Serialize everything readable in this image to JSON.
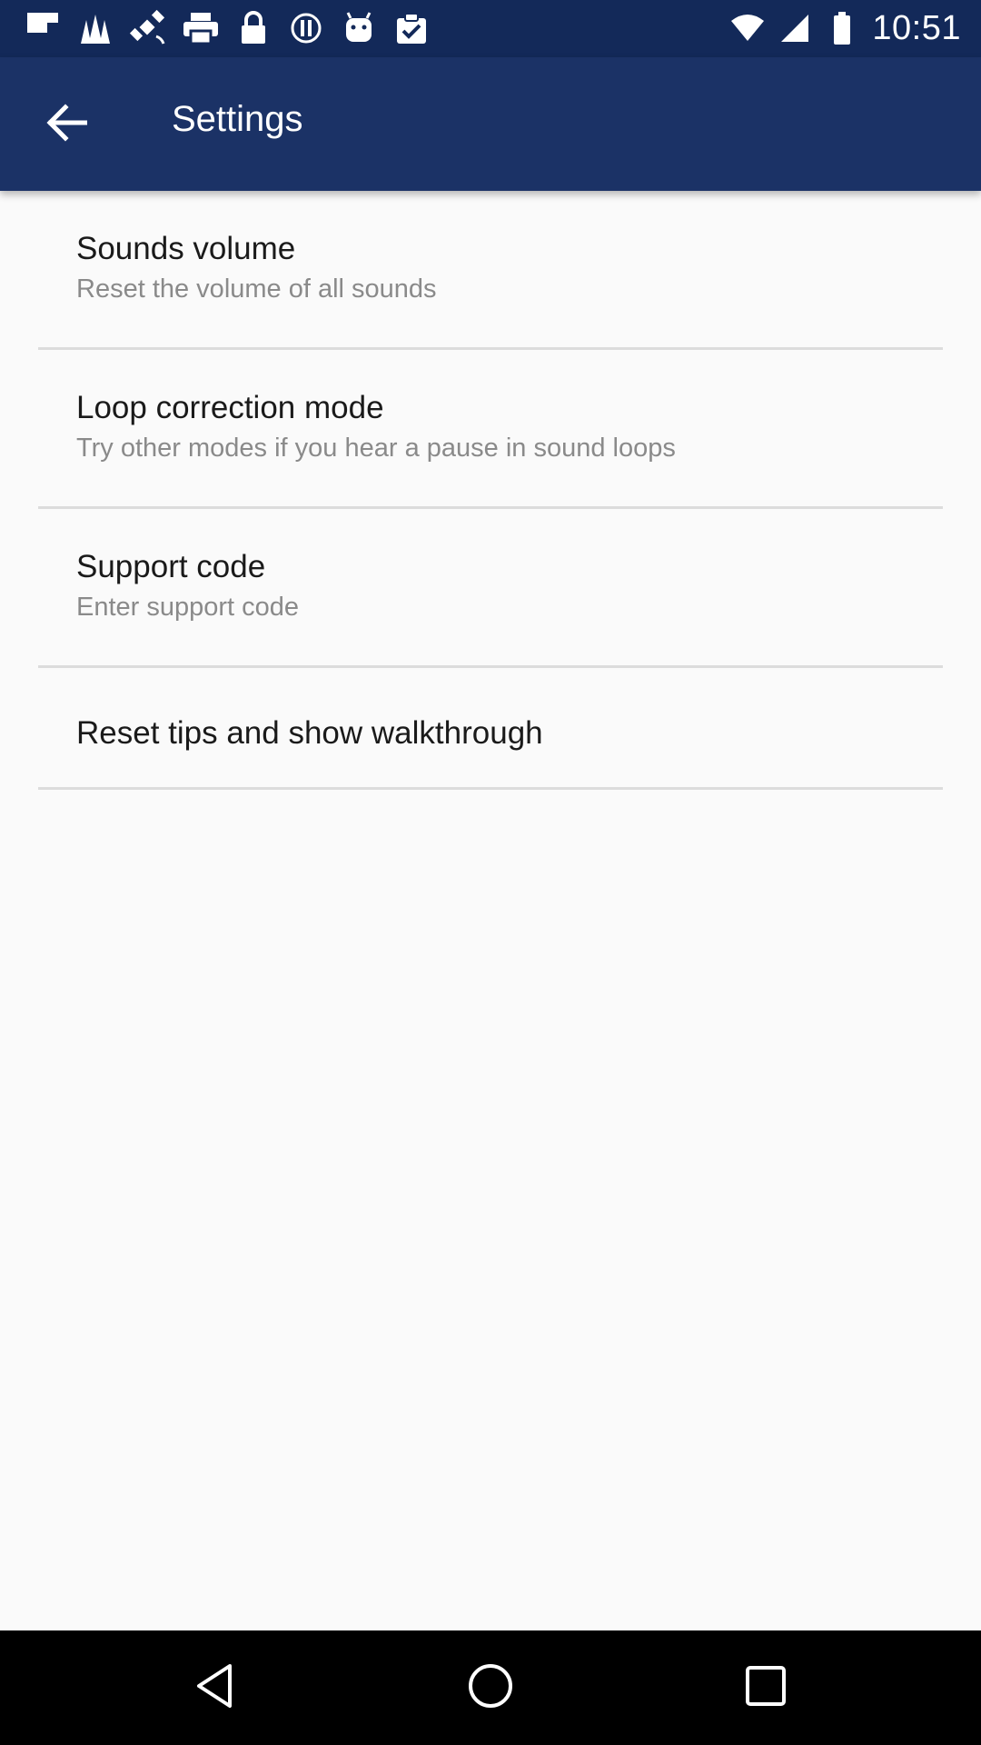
{
  "status_bar": {
    "time": "10:51",
    "left_icons": [
      "flipboard-icon",
      "grass-icon",
      "satellite-fake-icon",
      "printer-icon",
      "lock-icon",
      "info-circle-icon",
      "android-icon",
      "clipboard-check-icon"
    ],
    "right_icons": [
      "wifi-icon",
      "signal-icon",
      "battery-icon"
    ]
  },
  "app_bar": {
    "title": "Settings",
    "back_icon": "arrow-back-icon",
    "background": "#1b3266"
  },
  "settings": [
    {
      "title": "Sounds volume",
      "subtitle": "Reset the volume of all sounds"
    },
    {
      "title": "Loop correction mode",
      "subtitle": "Try other modes if you hear a pause in sound loops"
    },
    {
      "title": "Support code",
      "subtitle": "Enter support code"
    },
    {
      "title": "Reset tips and show walkthrough"
    }
  ],
  "nav_bar": {
    "buttons": [
      "back-triangle-icon",
      "home-circle-icon",
      "recents-square-icon"
    ]
  }
}
